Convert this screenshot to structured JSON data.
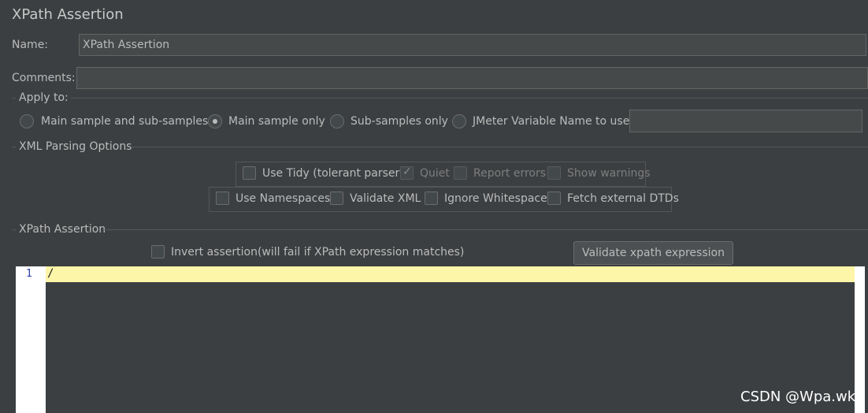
{
  "panel": {
    "title": "XPath Assertion"
  },
  "name_field": {
    "label": "Name:",
    "value": "XPath Assertion"
  },
  "comments_field": {
    "label": "Comments:",
    "value": ""
  },
  "apply_to": {
    "label": "Apply to:",
    "options": [
      {
        "label": "Main sample and sub-samples",
        "selected": false
      },
      {
        "label": "Main sample only",
        "selected": true
      },
      {
        "label": "Sub-samples only",
        "selected": false
      },
      {
        "label": "JMeter Variable Name to use",
        "selected": false
      }
    ],
    "variable_value": ""
  },
  "xml_parsing": {
    "label": "XML Parsing Options",
    "tidy_row": [
      {
        "label": "Use Tidy (tolerant parser)",
        "checked": false,
        "enabled": true
      },
      {
        "label": "Quiet",
        "checked": true,
        "enabled": false
      },
      {
        "label": "Report errors",
        "checked": false,
        "enabled": false
      },
      {
        "label": "Show warnings",
        "checked": false,
        "enabled": false
      }
    ],
    "ns_row": [
      {
        "label": "Use Namespaces",
        "checked": false
      },
      {
        "label": "Validate XML",
        "checked": false
      },
      {
        "label": "Ignore Whitespace",
        "checked": false
      },
      {
        "label": "Fetch external DTDs",
        "checked": false
      }
    ]
  },
  "xpath_assertion": {
    "label": "XPath Assertion",
    "invert_label": "Invert assertion(will fail if XPath expression matches)",
    "invert_checked": false,
    "validate_button": "Validate xpath expression",
    "editor": {
      "line_number": "1",
      "content": "/"
    }
  },
  "watermark": "CSDN @Wpa.wk"
}
